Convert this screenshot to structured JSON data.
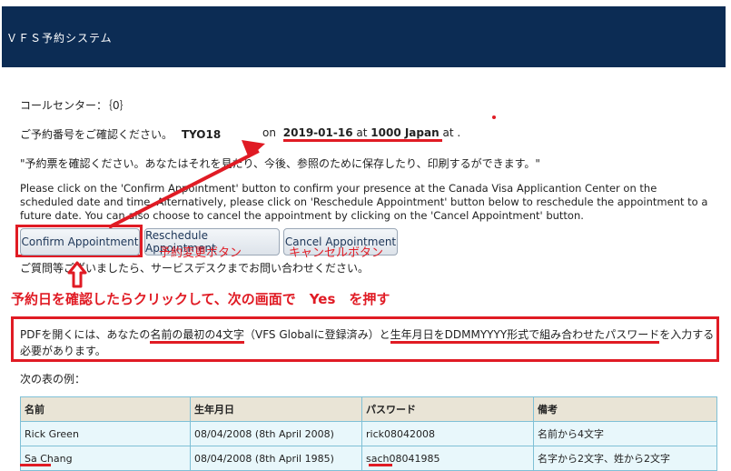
{
  "app": {
    "title": "ＶＦＳ予約システム"
  },
  "callcenter": "コールセンター：｛0｝",
  "confirm_line": {
    "prefix": "ご予約番号をご確認ください。",
    "ref": "TYO18",
    "on": "on",
    "date": "2019-01-16",
    "at": "at",
    "time": "1000 Japan",
    "suffix": "at ."
  },
  "print_note": "\"予約票を確認ください。あなたはそれを見たり、今後、参照のために保存したり、印刷するができます。\"",
  "instructions": "Please click on the 'Confirm Appointment' button to confirm your presence at the Canada Visa Applicantion Center on the scheduled date and time. Alternatively, please click on 'Reschedule Appointment' button below to reschedule the appointment to a future date. You can also choose to cancel the appointment by clicking on the 'Cancel Appointment' button.",
  "buttons": {
    "confirm": "Confirm Appointment",
    "reschedule": "Reschedule Appointment",
    "cancel": "Cancel Appointment"
  },
  "annotations": {
    "reschedule": "予約変更ボタン",
    "cancel": "キャンセルボタン",
    "click_hint": "予約日を確認したらクリックして、次の画面で　Yes　を押す",
    "colors": {
      "annotation": "#e01b24",
      "header": "#0c2c54"
    }
  },
  "help_line": "ご質問等ございましたら、サービスデスクまでお問い合わせください。",
  "pdf_note": {
    "line1_a": "PDFを開くには、あなたの",
    "line1_b": "名前の最初の4文字",
    "line1_c": "（VFS Globalに登録済み）と",
    "line1_d": "生年月日をDDMMYYYY形式",
    "line1_e": "で組み合わせた",
    "line1_f": "パスワード",
    "line1_g": "を入力する",
    "line2": "必要があります。"
  },
  "example_label": "次の表の例：",
  "table": {
    "headers": [
      "名前",
      "生年月日",
      "パスワード",
      "備考"
    ],
    "rows": [
      [
        "Rick Green",
        "08/04/2008 (8th April 2008)",
        "rick08042008",
        "名前から4文字"
      ],
      [
        "Sa Chang",
        "08/04/2008 (8th April 1985)",
        "sach08041985",
        "名字から2文字、姓から2文字"
      ]
    ]
  }
}
